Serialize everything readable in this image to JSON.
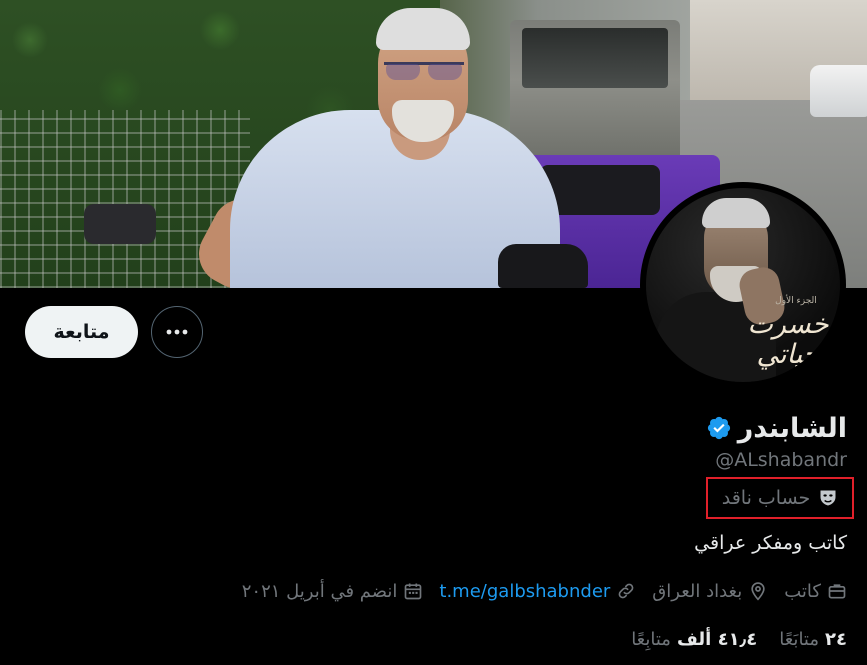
{
  "profile": {
    "display_name": "الشابندر",
    "handle": "@ALshabandr",
    "label": "حساب ناقد",
    "bio": "كاتب ومفكر عراقي",
    "verified_color": "#1d9bf0"
  },
  "avatar": {
    "title_text": "خسرت حياتي",
    "subtitle_text": "الجزء الأول"
  },
  "actions": {
    "follow_label": "متابعة"
  },
  "meta": {
    "joined": "انضم في أبريل ٢٠٢١",
    "link": "t.me/galbshabnder",
    "location": "بغداد العراق",
    "profession": "كاتب"
  },
  "stats": {
    "following_count": "٢٤",
    "following_label": "متابَعًا",
    "followers_count": "٤١٫٤ ألف",
    "followers_label": "متابِعًا"
  },
  "icons": {
    "more": "more-dots-icon",
    "verified": "verified-badge-icon",
    "label": "theater-mask-icon",
    "joined": "calendar-icon",
    "link": "link-icon",
    "location": "location-pin-icon",
    "profession": "briefcase-icon"
  }
}
